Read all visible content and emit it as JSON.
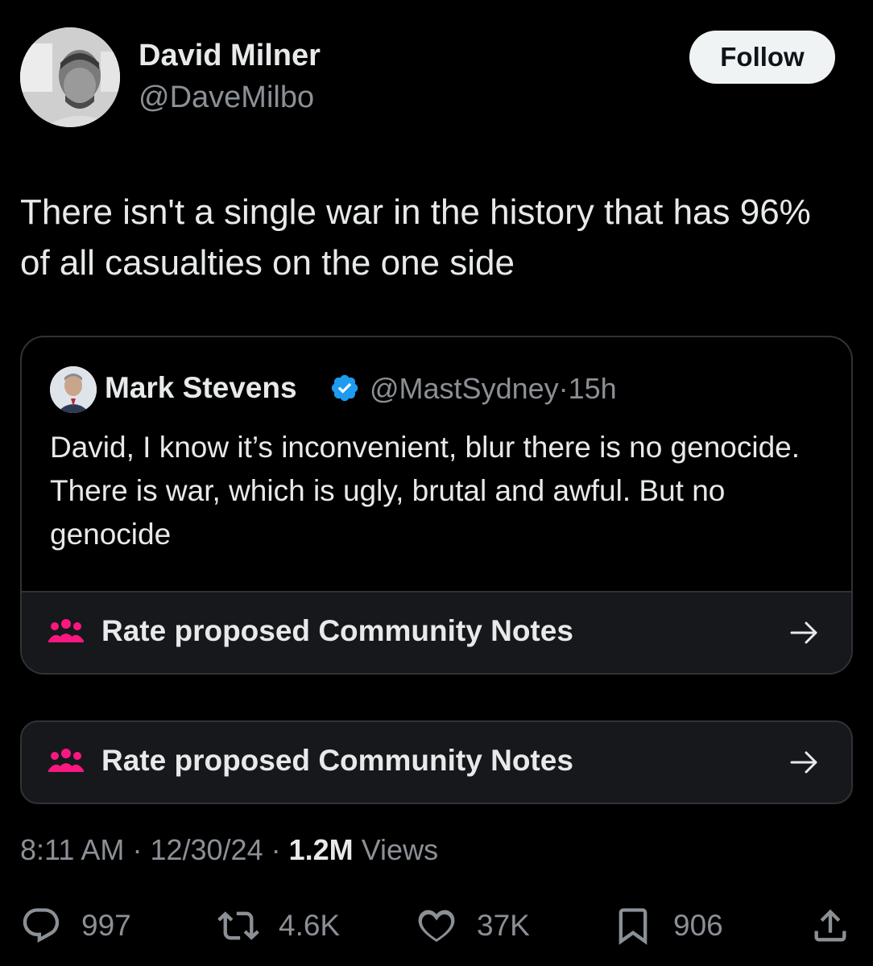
{
  "author": {
    "display_name": "David Milner",
    "handle": "@DaveMilbo",
    "avatar_icon": "profile-photo"
  },
  "follow_label": "Follow",
  "tweet_text": "There isn't a single war in the history that has 96% of all casualties on the one side",
  "quoted_tweet": {
    "display_name": "Mark Stevens",
    "verified": true,
    "handle": "@MastSydney",
    "separator": "·",
    "age": "15h",
    "text": "David, I know it’s inconvenient, blur there is no genocide. There is war, which is ugly, brutal and awful. But no genocide",
    "notes_label": "Rate proposed Community Notes"
  },
  "community_notes": {
    "label": "Rate proposed Community Notes",
    "icon": "people-icon",
    "accent_color": "#f91880"
  },
  "meta": {
    "time": "8:11 AM",
    "separator": "·",
    "date": "12/30/24",
    "views_count": "1.2M",
    "views_label": "Views"
  },
  "actions": {
    "replies": "997",
    "reposts": "4.6K",
    "likes": "37K",
    "bookmarks": "906"
  },
  "colors": {
    "background": "#000000",
    "text": "#e7e9ea",
    "secondary_text": "#8b9096",
    "verified": "#1d9bf0"
  }
}
